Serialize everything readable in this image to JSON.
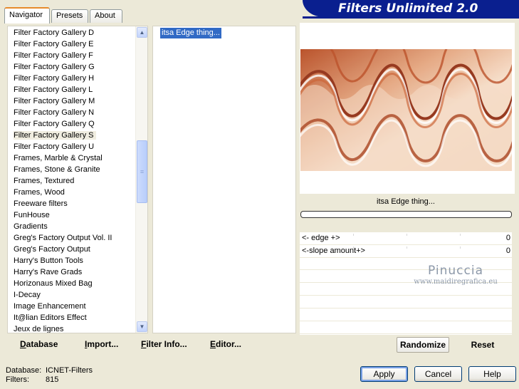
{
  "tabs": [
    "Navigator",
    "Presets",
    "About"
  ],
  "banner": "Filters Unlimited 2.0",
  "categories": [
    "Filter Factory Gallery D",
    "Filter Factory Gallery E",
    "Filter Factory Gallery F",
    "Filter Factory Gallery G",
    "Filter Factory Gallery H",
    "Filter Factory Gallery L",
    "Filter Factory Gallery M",
    "Filter Factory Gallery N",
    "Filter Factory Gallery Q",
    "Filter Factory Gallery S",
    "Filter Factory Gallery U",
    "Frames, Marble & Crystal",
    "Frames, Stone & Granite",
    "Frames, Textured",
    "Frames, Wood",
    "Freeware filters",
    "FunHouse",
    "Gradients",
    "Greg's Factory Output Vol. II",
    "Greg's Factory Output",
    "Harry's Button Tools",
    "Harry's Rave Grads",
    "Horizonaus Mixed Bag",
    "I-Decay",
    "Image Enhancement",
    "It@lian Editors Effect",
    "Jeux de lignes"
  ],
  "selected_category": "Filter Factory Gallery S",
  "filters": [
    "itsa Edge thing..."
  ],
  "selected_filter_title": "itsa Edge thing...",
  "progress": 0,
  "params": [
    {
      "label": "<- edge +>",
      "value": "0"
    },
    {
      "label": "<-slope amount+>",
      "value": "0"
    }
  ],
  "watermark": {
    "name": "Pinuccia",
    "url": "www.maidiregrafica.eu"
  },
  "links": {
    "database": "Database",
    "import": "Import...",
    "filter_info": "Filter Info...",
    "editor": "Editor..."
  },
  "buttons": {
    "randomize": "Randomize",
    "reset": "Reset",
    "apply": "Apply",
    "cancel": "Cancel",
    "help": "Help"
  },
  "status": {
    "database_label": "Database:",
    "database_value": "ICNET-Filters",
    "filters_label": "Filters:",
    "filters_value": "815"
  },
  "colors": {
    "selection": "#316ac5",
    "banner": "#0a1f8f",
    "preview_tone": "#c0582a"
  }
}
